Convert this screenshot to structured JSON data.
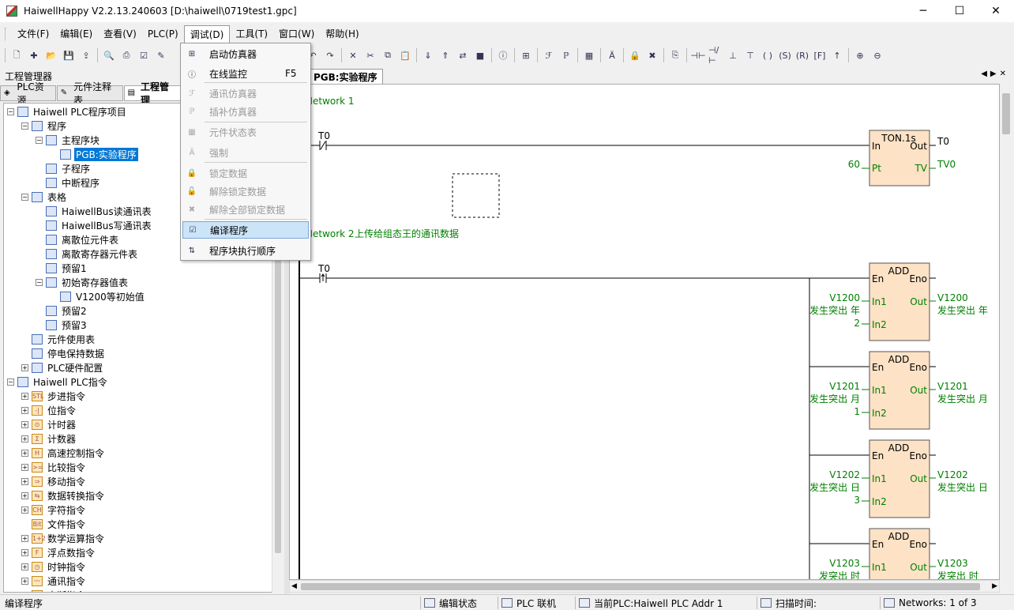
{
  "window": {
    "title": "HaiwellHappy V2.2.13.240603 [D:\\haiwell\\0719test1.gpc]",
    "minimize": "─",
    "maximize": "☐",
    "close": "✕"
  },
  "menu": [
    "文件(F)",
    "编辑(E)",
    "查看(V)",
    "PLC(P)",
    "调试(D)",
    "工具(T)",
    "窗口(W)",
    "帮助(H)"
  ],
  "debug_menu": {
    "items": [
      {
        "label": "启动仿真器",
        "shortcut": "",
        "enabled": true,
        "icon": "simulator-icon"
      },
      {
        "label": "在线监控",
        "shortcut": "F5",
        "enabled": true,
        "icon": "monitor-icon"
      },
      {
        "label": "通讯仿真器",
        "shortcut": "",
        "enabled": false,
        "icon": "comm-sim-icon"
      },
      {
        "label": "插补仿真器",
        "shortcut": "",
        "enabled": false,
        "icon": "interp-sim-icon"
      },
      {
        "label": "元件状态表",
        "shortcut": "",
        "enabled": false,
        "icon": "status-table-icon"
      },
      {
        "label": "强制",
        "shortcut": "",
        "enabled": false,
        "icon": "force-icon"
      },
      {
        "label": "锁定数据",
        "shortcut": "",
        "enabled": false,
        "icon": "lock-icon"
      },
      {
        "label": "解除锁定数据",
        "shortcut": "",
        "enabled": false,
        "icon": "unlock-icon"
      },
      {
        "label": "解除全部锁定数据",
        "shortcut": "",
        "enabled": false,
        "icon": "unlock-all-icon"
      },
      {
        "label": "编译程序",
        "shortcut": "",
        "enabled": true,
        "icon": "compile-icon"
      },
      {
        "label": "程序块执行顺序",
        "shortcut": "",
        "enabled": true,
        "icon": "order-icon"
      }
    ]
  },
  "left_panel": {
    "header": "工程管理器",
    "tabs": [
      "PLC资源",
      "元件注释表",
      "工程管理"
    ],
    "tree": [
      {
        "label": "Haiwell PLC程序项目",
        "level": 0,
        "exp": "-"
      },
      {
        "label": "程序",
        "level": 1,
        "exp": "-"
      },
      {
        "label": "主程序块",
        "level": 2,
        "exp": "-"
      },
      {
        "label": "PGB:实验程序",
        "level": 3,
        "exp": "",
        "selected": true
      },
      {
        "label": "子程序",
        "level": 2,
        "exp": ""
      },
      {
        "label": "中断程序",
        "level": 2,
        "exp": ""
      },
      {
        "label": "表格",
        "level": 1,
        "exp": "-"
      },
      {
        "label": "HaiwellBus读通讯表",
        "level": 2,
        "exp": ""
      },
      {
        "label": "HaiwellBus写通讯表",
        "level": 2,
        "exp": ""
      },
      {
        "label": "离散位元件表",
        "level": 2,
        "exp": ""
      },
      {
        "label": "离散寄存器元件表",
        "level": 2,
        "exp": ""
      },
      {
        "label": "预留1",
        "level": 2,
        "exp": ""
      },
      {
        "label": "初始寄存器值表",
        "level": 2,
        "exp": "-"
      },
      {
        "label": "V1200等初始值",
        "level": 3,
        "exp": ""
      },
      {
        "label": "预留2",
        "level": 2,
        "exp": ""
      },
      {
        "label": "预留3",
        "level": 2,
        "exp": ""
      },
      {
        "label": "元件使用表",
        "level": 1,
        "exp": ""
      },
      {
        "label": "停电保持数据",
        "level": 1,
        "exp": ""
      },
      {
        "label": "PLC硬件配置",
        "level": 1,
        "exp": "+"
      },
      {
        "label": "Haiwell PLC指令",
        "level": 0,
        "exp": "-"
      },
      {
        "label": "步进指令",
        "level": 1,
        "exp": "+",
        "ins": "STL"
      },
      {
        "label": "位指令",
        "level": 1,
        "exp": "+",
        "ins": "-|"
      },
      {
        "label": "计时器",
        "level": 1,
        "exp": "+",
        "ins": "⊙"
      },
      {
        "label": "计数器",
        "level": 1,
        "exp": "+",
        "ins": "Σ"
      },
      {
        "label": "高速控制指令",
        "level": 1,
        "exp": "+",
        "ins": "H"
      },
      {
        "label": "比较指令",
        "level": 1,
        "exp": "+",
        "ins": ">="
      },
      {
        "label": "移动指令",
        "level": 1,
        "exp": "+",
        "ins": "⇒"
      },
      {
        "label": "数据转换指令",
        "level": 1,
        "exp": "+",
        "ins": "⇆"
      },
      {
        "label": "字符指令",
        "level": 1,
        "exp": "+",
        "ins": "CH"
      },
      {
        "label": "文件指令",
        "level": 1,
        "exp": "",
        "ins": "Bit"
      },
      {
        "label": "数学运算指令",
        "level": 1,
        "exp": "+",
        "ins": "1+2"
      },
      {
        "label": "浮点数指令",
        "level": 1,
        "exp": "+",
        "ins": "F"
      },
      {
        "label": "时钟指令",
        "level": 1,
        "exp": "+",
        "ins": "◷"
      },
      {
        "label": "通讯指令",
        "level": 1,
        "exp": "+",
        "ins": "〰"
      },
      {
        "label": "中断指令",
        "level": 1,
        "exp": "+",
        "ins": "!"
      }
    ]
  },
  "doc_tab": "PGB:实验程序",
  "ladder": {
    "network1": {
      "title": "Network 1",
      "contact": "T0",
      "block": "TON.1s",
      "in": "In",
      "out": "Out",
      "out_var": "T0",
      "pt_val": "60",
      "pt": "Pt",
      "tv": "TV",
      "tv_var": "TV0"
    },
    "network2": {
      "title": "Network 2",
      "comment": "上传给组态王的通讯数据",
      "contact": "T0"
    },
    "add_blocks": [
      {
        "in1_var": "V1200",
        "in1_desc": "发生突出 年",
        "in2_val": "2",
        "out_var": "V1200",
        "out_desc": "发生突出 年"
      },
      {
        "in1_var": "V1201",
        "in1_desc": "发生突出 月",
        "in2_val": "1",
        "out_var": "V1201",
        "out_desc": "发生突出 月"
      },
      {
        "in1_var": "V1202",
        "in1_desc": "发生突出 日",
        "in2_val": "3",
        "out_var": "V1202",
        "out_desc": "发生突出 日"
      },
      {
        "in1_var": "V1203",
        "in1_desc": "发突出 时",
        "in2_val": "",
        "out_var": "V1203",
        "out_desc": "发突出 时"
      }
    ],
    "add_labels": {
      "name": "ADD",
      "en": "En",
      "eno": "Eno",
      "in1": "In1",
      "in2": "In2",
      "out": "Out"
    }
  },
  "status": {
    "left": "编译程序",
    "mode": "编辑状态",
    "conn": "PLC 联机",
    "plc": "当前PLC:Haiwell PLC Addr 1",
    "scan": "扫描时间:",
    "networks": "Networks:  1 of 3"
  },
  "colors": {
    "block_fill": "#fde2c5",
    "green_text": "#008000",
    "selection": "#0078d7"
  }
}
